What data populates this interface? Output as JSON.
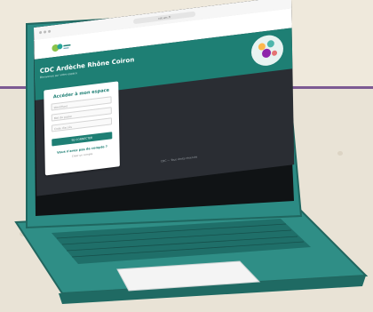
{
  "site": {
    "title": "CDC Ardèche Rhône Coiron",
    "subtitle": "Bienvenue sur votre espace",
    "url": "cdc-arc.fr"
  },
  "login": {
    "heading": "Accéder à mon espace",
    "fields": [
      {
        "placeholder": "Identifiant"
      },
      {
        "placeholder": "Mot de passe"
      },
      {
        "placeholder": "Code d'accès"
      }
    ],
    "submit_label": "SE CONNECTER",
    "forgot_title": "Vous n'avez pas de compte ?",
    "forgot_link": "Créer un compte"
  },
  "footer": {
    "text": "CDC — Tous droits réservés"
  },
  "colors": {
    "brand_teal": "#1e7f74",
    "laptop_body": "#2f8e86",
    "background": "#e9e3d6",
    "divider_purple": "#7c5a93"
  }
}
